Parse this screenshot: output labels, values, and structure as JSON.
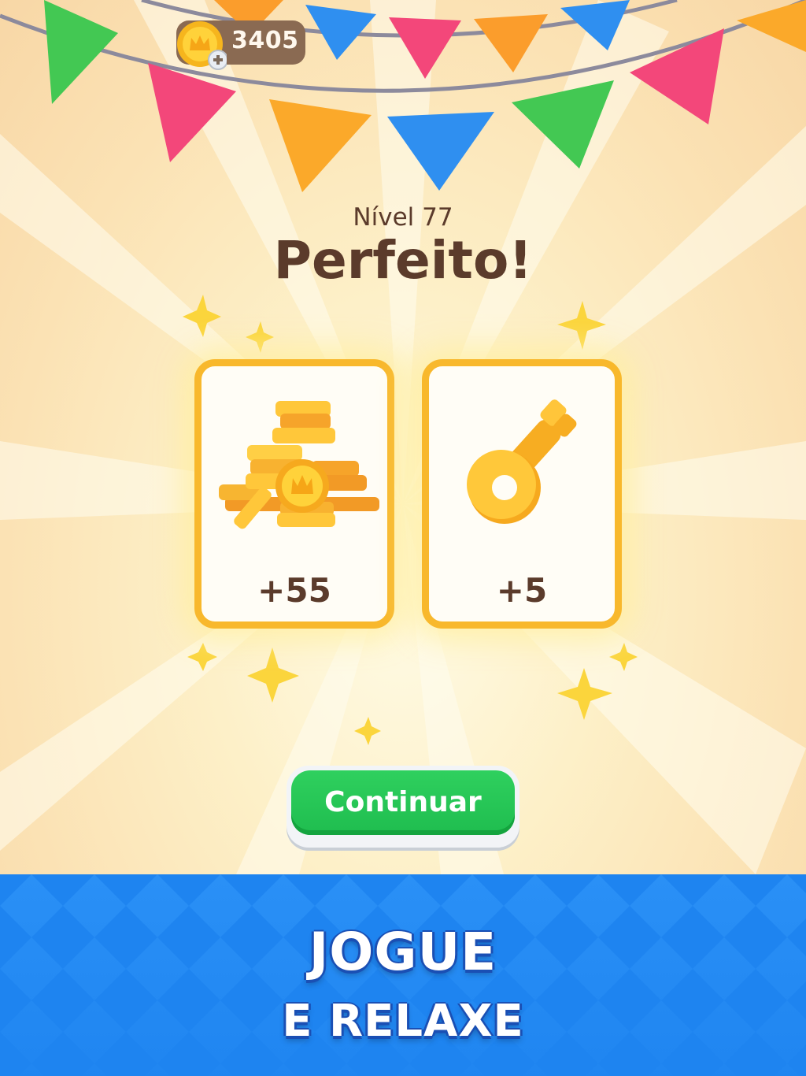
{
  "hud": {
    "coins": "3405",
    "coin_icon": "crown-coin-icon",
    "add_icon": "plus-icon"
  },
  "result": {
    "level_label": "Nível 77",
    "title": "Perfeito!"
  },
  "rewards": [
    {
      "name": "coins",
      "amount": "+55",
      "icon": "coin-pile-icon"
    },
    {
      "name": "keys",
      "amount": "+5",
      "icon": "key-icon"
    }
  ],
  "actions": {
    "continue_label": "Continuar"
  },
  "banner": {
    "line1": "JOGUE",
    "line2": "E RELAXE"
  },
  "colors": {
    "card_border": "#f8b82c",
    "button_green": "#1fbd4f",
    "banner_blue": "#1e84f0",
    "text_brown": "#5b3b2b",
    "star_yellow": "#fbd53c"
  }
}
